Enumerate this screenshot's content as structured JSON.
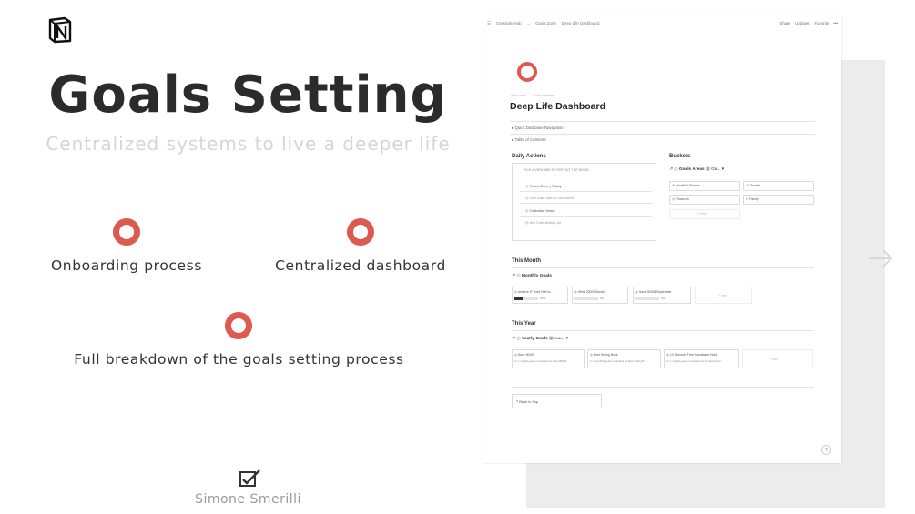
{
  "left": {
    "title": "Goals Setting",
    "subtitle": "Centralized systems to live a deeper life",
    "features": [
      {
        "label": "Onboarding process"
      },
      {
        "label": "Centralized dashboard"
      },
      {
        "label": "Full breakdown of the goals setting process"
      }
    ],
    "author": "Simone Smerilli"
  },
  "colors": {
    "accent": "#de5a50",
    "shadow": "#ececec"
  },
  "screenshot": {
    "breadcrumbs": [
      "Creativity Hub",
      "...",
      "Goals Zone",
      "Deep Life Dashboard"
    ],
    "actions": [
      "Share",
      "Updates",
      "Favorite",
      "•••"
    ],
    "meta": [
      "Add cover",
      "Add comment"
    ],
    "page_title": "Deep Life Dashboard",
    "toggles": [
      "Quick Database Navigation",
      "Table of Contents"
    ],
    "daily_actions": {
      "heading": "Daily Actions",
      "hint": "PICK A VIEW AND FILTER OUT THE NOISE",
      "items": [
        "Focus Zone | Today",
        "Due Date Within One Week",
        "Calendar Views",
        "Not Completed | All"
      ]
    },
    "buckets": {
      "heading": "Buckets",
      "db_title": "Goals Areas",
      "view": "Ga...",
      "cards": [
        "Health & Fitness",
        "Growth",
        "Finances",
        "Family"
      ],
      "new": "+ New"
    },
    "this_month": {
      "heading": "This Month",
      "db_title": "Monthly Goals",
      "cards": [
        {
          "name": "Achieve 5\" Hold Feet to...",
          "progress": 0.33,
          "label": "33%"
        },
        {
          "name": "Write 20000 Words",
          "progress": 0,
          "label": "0%"
        },
        {
          "name": "Save 3000$ September",
          "progress": 0,
          "label": "0%"
        }
      ],
      "new": "+ New"
    },
    "this_year": {
      "heading": "This Year",
      "db_title": "Yearly Goals",
      "view": "Gallery",
      "cards": [
        {
          "name": "Save 8000$",
          "sub": "0 / 1 monthly goals completed for Save 8000$"
        },
        {
          "name": "Best Selling Book",
          "sub": "0 / 1 monthly goals completed for Best Selling B..."
        },
        {
          "name": "10 Seconds Free Handstand Hold",
          "sub": "0 / 1 monthly goals completed for 10 Seconds Fr..."
        }
      ],
      "new": "+ New"
    },
    "back_to_top": "Back to Top",
    "help": "?"
  }
}
